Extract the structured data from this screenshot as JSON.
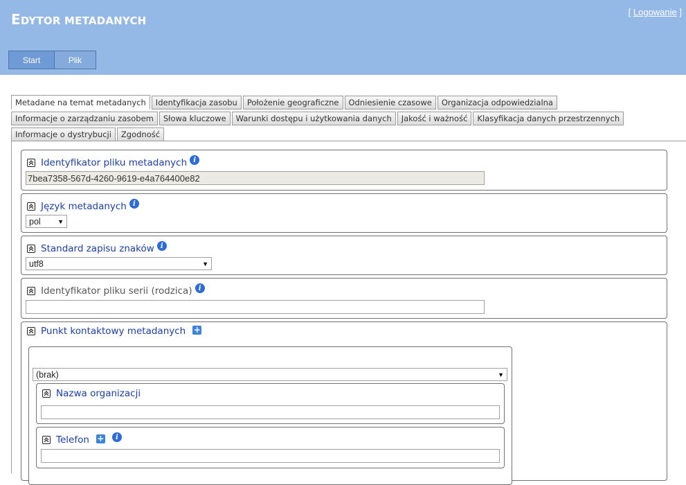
{
  "app": {
    "title_first": "E",
    "title_rest": "DYTOR METADANYCH",
    "login_prefix": "[ ",
    "login_link": "Logowanie",
    "login_suffix": " ]"
  },
  "menu": {
    "items": [
      "Start",
      "Plik"
    ]
  },
  "tabs": {
    "row1": [
      "Metadane na temat metadanych",
      "Identyfikacja zasobu",
      "Położenie geograficzne",
      "Odniesienie czasowe",
      "Organizacja odpowiedzialna"
    ],
    "row2": [
      "Informacje o zarządzaniu zasobem",
      "Słowa kluczowe",
      "Warunki dostępu i użytkowania danych",
      "Jakość i ważność",
      "Klasyfikacja danych przestrzennych"
    ],
    "row3": [
      "Informacje o dystrybucji",
      "Zgodność"
    ]
  },
  "fields": {
    "file_id": {
      "label": "Identyfikator pliku metadanych",
      "value": "7bea7358-567d-4260-9619-e4a764400e82"
    },
    "language": {
      "label": "Język metadanych",
      "value": "pol"
    },
    "charset": {
      "label": "Standard zapisu znaków",
      "value": "utf8"
    },
    "parent_id": {
      "label": "Identyfikator pliku serii (rodzica)",
      "value": ""
    },
    "contact": {
      "label": "Punkt kontaktowy metadanych",
      "select_value": "(brak)",
      "org_label": "Nazwa organizacji",
      "org_value": "",
      "phone_label": "Telefon",
      "phone_value": ""
    }
  },
  "icons": {
    "collapse": "double-chevron-up-icon",
    "info": "info-icon",
    "add": "plus-icon"
  },
  "colors": {
    "header_bg": "#95b9e6",
    "menu_btn": "#6f9ad6",
    "label_blue": "#1a3fa8",
    "icon_blue": "#2d6bd6"
  }
}
